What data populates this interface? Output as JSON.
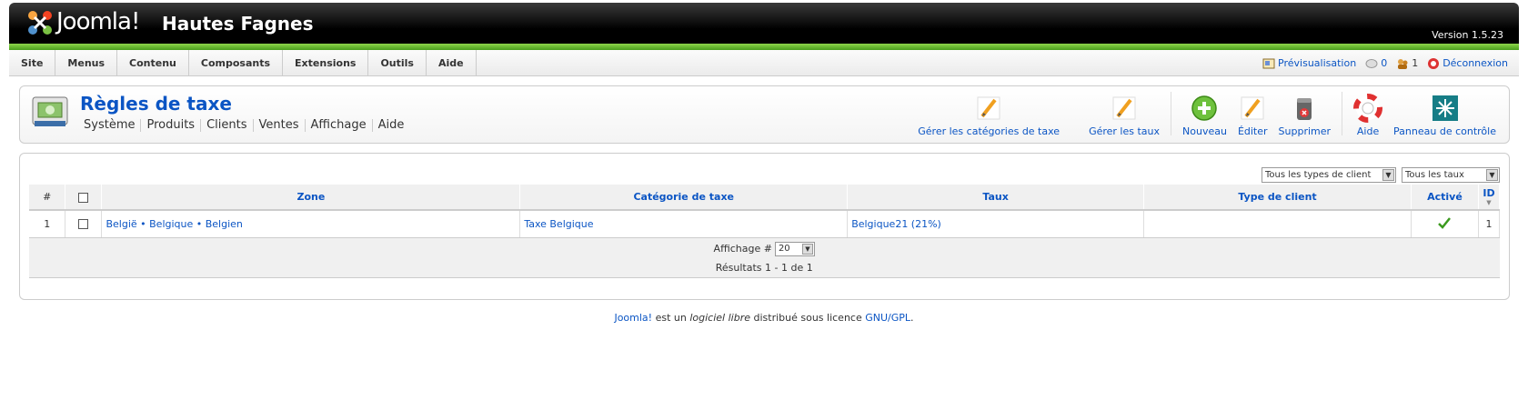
{
  "header": {
    "logo_text": "Joomla!",
    "site_name": "Hautes Fagnes",
    "version": "Version 1.5.23"
  },
  "menu": [
    "Site",
    "Menus",
    "Contenu",
    "Composants",
    "Extensions",
    "Outils",
    "Aide"
  ],
  "status": {
    "preview": "Prévisualisation",
    "messages": "0",
    "users": "1",
    "logout": "Déconnexion"
  },
  "page": {
    "title": "Règles de taxe",
    "submenu": [
      "Système",
      "Produits",
      "Clients",
      "Ventes",
      "Affichage",
      "Aide"
    ]
  },
  "toolbar": [
    {
      "label": "Gérer les catégories de taxe",
      "icon": "pencil-icon"
    },
    {
      "label": "Gérer les taux",
      "icon": "pencil-icon"
    },
    {
      "label": "Nouveau",
      "icon": "new-icon"
    },
    {
      "label": "Éditer",
      "icon": "pencil-icon"
    },
    {
      "label": "Supprimer",
      "icon": "delete-icon"
    },
    {
      "label": "Aide",
      "icon": "help-icon"
    },
    {
      "label": "Panneau de contrôle",
      "icon": "control-panel-icon"
    }
  ],
  "filters": {
    "client_type": "Tous les types de client",
    "rate": "Tous les taux"
  },
  "table": {
    "headers": {
      "num": "#",
      "zone": "Zone",
      "category": "Catégorie de taxe",
      "rate": "Taux",
      "client_type": "Type de client",
      "active": "Activé",
      "id": "ID"
    },
    "rows": [
      {
        "num": "1",
        "zone": "België • Belgique • Belgien",
        "category": "Taxe Belgique",
        "rate": "Belgique21 (21%)",
        "client_type": "",
        "active": true,
        "id": "1"
      }
    ],
    "display_label": "Affichage #",
    "display_value": "20",
    "results": "Résultats 1 - 1 de 1"
  },
  "footer": {
    "brand": "Joomla!",
    "text1": " est un ",
    "italic": "logiciel libre",
    "text2": " distribué sous licence ",
    "license": "GNU/GPL",
    "end": "."
  },
  "colors": {
    "link": "#0b55c4",
    "green_bar": "#6abf2e",
    "header": "#000000"
  }
}
